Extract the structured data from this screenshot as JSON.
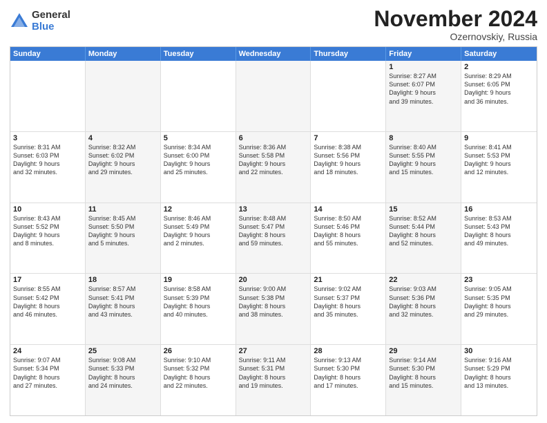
{
  "logo": {
    "general": "General",
    "blue": "Blue"
  },
  "title": "November 2024",
  "location": "Ozernovskiy, Russia",
  "header_days": [
    "Sunday",
    "Monday",
    "Tuesday",
    "Wednesday",
    "Thursday",
    "Friday",
    "Saturday"
  ],
  "rows": [
    [
      {
        "day": "",
        "lines": [],
        "alt": false
      },
      {
        "day": "",
        "lines": [],
        "alt": true
      },
      {
        "day": "",
        "lines": [],
        "alt": false
      },
      {
        "day": "",
        "lines": [],
        "alt": true
      },
      {
        "day": "",
        "lines": [],
        "alt": false
      },
      {
        "day": "1",
        "lines": [
          "Sunrise: 8:27 AM",
          "Sunset: 6:07 PM",
          "Daylight: 9 hours",
          "and 39 minutes."
        ],
        "alt": true
      },
      {
        "day": "2",
        "lines": [
          "Sunrise: 8:29 AM",
          "Sunset: 6:05 PM",
          "Daylight: 9 hours",
          "and 36 minutes."
        ],
        "alt": false
      }
    ],
    [
      {
        "day": "3",
        "lines": [
          "Sunrise: 8:31 AM",
          "Sunset: 6:03 PM",
          "Daylight: 9 hours",
          "and 32 minutes."
        ],
        "alt": false
      },
      {
        "day": "4",
        "lines": [
          "Sunrise: 8:32 AM",
          "Sunset: 6:02 PM",
          "Daylight: 9 hours",
          "and 29 minutes."
        ],
        "alt": true
      },
      {
        "day": "5",
        "lines": [
          "Sunrise: 8:34 AM",
          "Sunset: 6:00 PM",
          "Daylight: 9 hours",
          "and 25 minutes."
        ],
        "alt": false
      },
      {
        "day": "6",
        "lines": [
          "Sunrise: 8:36 AM",
          "Sunset: 5:58 PM",
          "Daylight: 9 hours",
          "and 22 minutes."
        ],
        "alt": true
      },
      {
        "day": "7",
        "lines": [
          "Sunrise: 8:38 AM",
          "Sunset: 5:56 PM",
          "Daylight: 9 hours",
          "and 18 minutes."
        ],
        "alt": false
      },
      {
        "day": "8",
        "lines": [
          "Sunrise: 8:40 AM",
          "Sunset: 5:55 PM",
          "Daylight: 9 hours",
          "and 15 minutes."
        ],
        "alt": true
      },
      {
        "day": "9",
        "lines": [
          "Sunrise: 8:41 AM",
          "Sunset: 5:53 PM",
          "Daylight: 9 hours",
          "and 12 minutes."
        ],
        "alt": false
      }
    ],
    [
      {
        "day": "10",
        "lines": [
          "Sunrise: 8:43 AM",
          "Sunset: 5:52 PM",
          "Daylight: 9 hours",
          "and 8 minutes."
        ],
        "alt": false
      },
      {
        "day": "11",
        "lines": [
          "Sunrise: 8:45 AM",
          "Sunset: 5:50 PM",
          "Daylight: 9 hours",
          "and 5 minutes."
        ],
        "alt": true
      },
      {
        "day": "12",
        "lines": [
          "Sunrise: 8:46 AM",
          "Sunset: 5:49 PM",
          "Daylight: 9 hours",
          "and 2 minutes."
        ],
        "alt": false
      },
      {
        "day": "13",
        "lines": [
          "Sunrise: 8:48 AM",
          "Sunset: 5:47 PM",
          "Daylight: 8 hours",
          "and 59 minutes."
        ],
        "alt": true
      },
      {
        "day": "14",
        "lines": [
          "Sunrise: 8:50 AM",
          "Sunset: 5:46 PM",
          "Daylight: 8 hours",
          "and 55 minutes."
        ],
        "alt": false
      },
      {
        "day": "15",
        "lines": [
          "Sunrise: 8:52 AM",
          "Sunset: 5:44 PM",
          "Daylight: 8 hours",
          "and 52 minutes."
        ],
        "alt": true
      },
      {
        "day": "16",
        "lines": [
          "Sunrise: 8:53 AM",
          "Sunset: 5:43 PM",
          "Daylight: 8 hours",
          "and 49 minutes."
        ],
        "alt": false
      }
    ],
    [
      {
        "day": "17",
        "lines": [
          "Sunrise: 8:55 AM",
          "Sunset: 5:42 PM",
          "Daylight: 8 hours",
          "and 46 minutes."
        ],
        "alt": false
      },
      {
        "day": "18",
        "lines": [
          "Sunrise: 8:57 AM",
          "Sunset: 5:41 PM",
          "Daylight: 8 hours",
          "and 43 minutes."
        ],
        "alt": true
      },
      {
        "day": "19",
        "lines": [
          "Sunrise: 8:58 AM",
          "Sunset: 5:39 PM",
          "Daylight: 8 hours",
          "and 40 minutes."
        ],
        "alt": false
      },
      {
        "day": "20",
        "lines": [
          "Sunrise: 9:00 AM",
          "Sunset: 5:38 PM",
          "Daylight: 8 hours",
          "and 38 minutes."
        ],
        "alt": true
      },
      {
        "day": "21",
        "lines": [
          "Sunrise: 9:02 AM",
          "Sunset: 5:37 PM",
          "Daylight: 8 hours",
          "and 35 minutes."
        ],
        "alt": false
      },
      {
        "day": "22",
        "lines": [
          "Sunrise: 9:03 AM",
          "Sunset: 5:36 PM",
          "Daylight: 8 hours",
          "and 32 minutes."
        ],
        "alt": true
      },
      {
        "day": "23",
        "lines": [
          "Sunrise: 9:05 AM",
          "Sunset: 5:35 PM",
          "Daylight: 8 hours",
          "and 29 minutes."
        ],
        "alt": false
      }
    ],
    [
      {
        "day": "24",
        "lines": [
          "Sunrise: 9:07 AM",
          "Sunset: 5:34 PM",
          "Daylight: 8 hours",
          "and 27 minutes."
        ],
        "alt": false
      },
      {
        "day": "25",
        "lines": [
          "Sunrise: 9:08 AM",
          "Sunset: 5:33 PM",
          "Daylight: 8 hours",
          "and 24 minutes."
        ],
        "alt": true
      },
      {
        "day": "26",
        "lines": [
          "Sunrise: 9:10 AM",
          "Sunset: 5:32 PM",
          "Daylight: 8 hours",
          "and 22 minutes."
        ],
        "alt": false
      },
      {
        "day": "27",
        "lines": [
          "Sunrise: 9:11 AM",
          "Sunset: 5:31 PM",
          "Daylight: 8 hours",
          "and 19 minutes."
        ],
        "alt": true
      },
      {
        "day": "28",
        "lines": [
          "Sunrise: 9:13 AM",
          "Sunset: 5:30 PM",
          "Daylight: 8 hours",
          "and 17 minutes."
        ],
        "alt": false
      },
      {
        "day": "29",
        "lines": [
          "Sunrise: 9:14 AM",
          "Sunset: 5:30 PM",
          "Daylight: 8 hours",
          "and 15 minutes."
        ],
        "alt": true
      },
      {
        "day": "30",
        "lines": [
          "Sunrise: 9:16 AM",
          "Sunset: 5:29 PM",
          "Daylight: 8 hours",
          "and 13 minutes."
        ],
        "alt": false
      }
    ]
  ]
}
